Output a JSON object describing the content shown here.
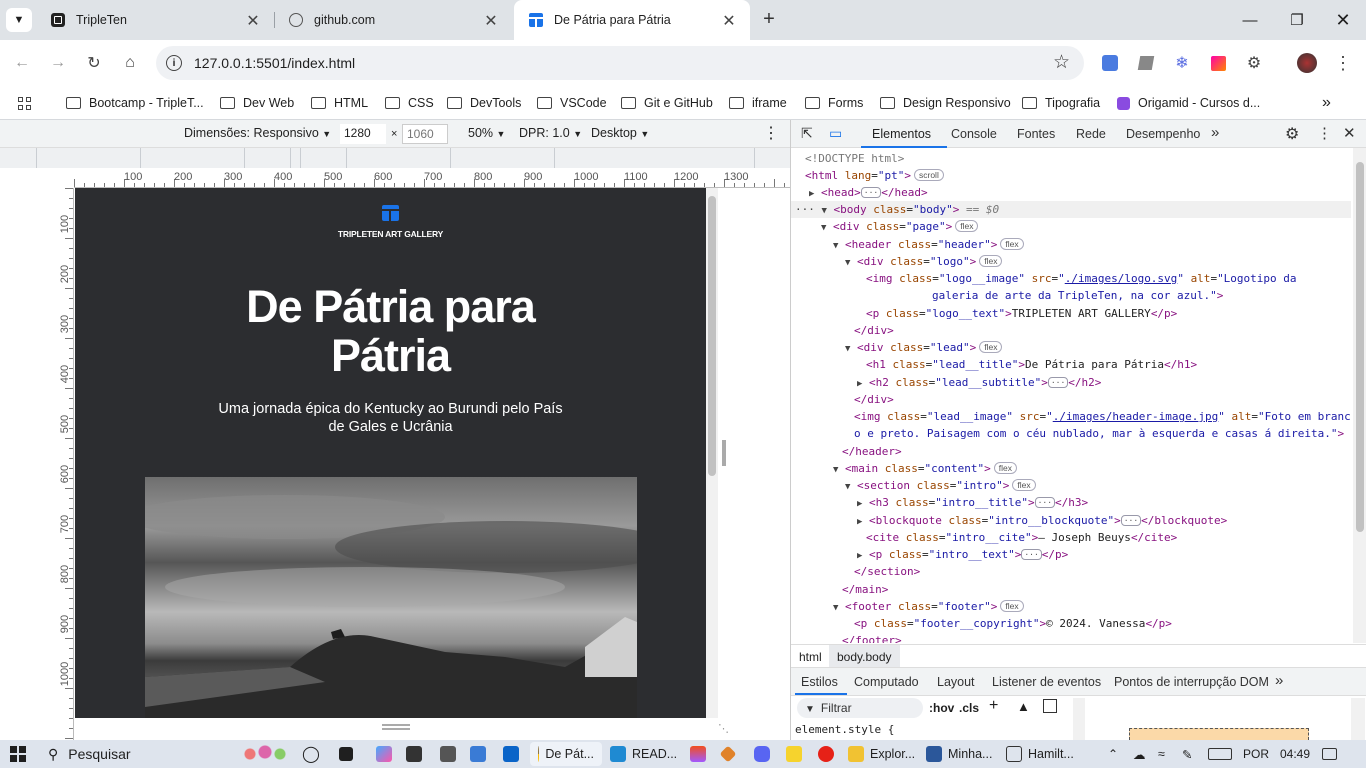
{
  "tabs": [
    {
      "title": "TripleTen",
      "active": false
    },
    {
      "title": "github.com",
      "active": false
    },
    {
      "title": "De Pátria para Pátria",
      "active": true
    }
  ],
  "toolbar": {
    "url": "127.0.0.1:5501/index.html"
  },
  "bookmarks": [
    "Bootcamp - TripleT...",
    "Dev Web",
    "HTML",
    "CSS",
    "DevTools",
    "VSCode",
    "Git e GitHub",
    "iframe",
    "Forms",
    "Design Responsivo",
    "Tipografia",
    "Origamid - Cursos d..."
  ],
  "device": {
    "dimensions_label": "Dimensões: Responsivo",
    "width": "1280",
    "height": "1060",
    "zoom": "50%",
    "dpr": "DPR: 1.0",
    "mode": "Desktop"
  },
  "ruler": {
    "h": [
      "100",
      "200",
      "300",
      "400",
      "500",
      "600",
      "700",
      "800",
      "900",
      "1000",
      "1100",
      "1200",
      "1300"
    ],
    "v": [
      "100",
      "200",
      "300",
      "400",
      "500",
      "600",
      "700",
      "800",
      "900",
      "1000"
    ]
  },
  "site": {
    "logo_text": "TRIPLETEN ART GALLERY",
    "title": "De Pátria para Pátria",
    "subtitle": "Uma jornada épica do Kentucky ao Burundi pelo País de Gales e Ucrânia"
  },
  "devtools": {
    "tabs": [
      "Elementos",
      "Console",
      "Fontes",
      "Rede",
      "Desempenho"
    ],
    "crumbs": [
      "html",
      "body.body"
    ],
    "style_tabs": [
      "Estilos",
      "Computado",
      "Layout",
      "Listener de eventos",
      "Pontos de interrupção DOM"
    ],
    "filter_placeholder": "Filtrar",
    "hov": ":hov",
    "cls": ".cls",
    "element_style": "element.style {"
  },
  "taskbar": {
    "search": "Pesquisar",
    "items": [
      "De Pát...",
      "READ...",
      "Explor...",
      "Minha...",
      "Hamilt..."
    ],
    "lang": "POR",
    "time": "04:49"
  }
}
